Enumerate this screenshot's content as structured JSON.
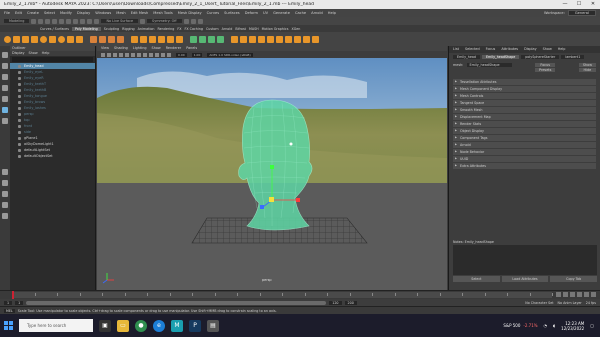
{
  "window": {
    "title": "Emily_2_1.mb* - Autodesk MAYA 2023: C:\\Users\\user\\Downloads\\Compressed\\Emily_2_1_Usert_Tutorial_Files\\Emily_2_1.mb   ---   Emily_head",
    "minimize": "—",
    "maximize": "☐",
    "close": "✕"
  },
  "menubar": {
    "items": [
      "File",
      "Edit",
      "Create",
      "Select",
      "Modify",
      "Display",
      "Windows",
      "Mesh",
      "Edit Mesh",
      "Mesh Tools",
      "Mesh Display",
      "Curves",
      "Surfaces",
      "Deform",
      "UV",
      "Generate",
      "Cache",
      "Arnold",
      "Help"
    ],
    "workspace_label": "Workspace:",
    "workspace_value": "General"
  },
  "statusline": {
    "mode": "Modeling",
    "live": "No Live Surface",
    "symmetry": "Symmetry: Off"
  },
  "shelf": {
    "tabs": [
      "Curves / Surfaces",
      "Poly Modeling",
      "Sculpting",
      "Rigging",
      "Animation",
      "Rendering",
      "FX",
      "FX Caching",
      "Custom",
      "Arnold",
      "Bifrost",
      "MASH",
      "Motion Graphics",
      "XGen"
    ],
    "active_tab": "Poly Modeling"
  },
  "outliner": {
    "title": "Outliner",
    "menu": [
      "Display",
      "Show",
      "Help"
    ],
    "items": [
      {
        "label": "Emily_head",
        "state": "selected"
      },
      {
        "label": "Emily_eyeL",
        "state": "dim"
      },
      {
        "label": "Emily_eyeR",
        "state": "dim"
      },
      {
        "label": "Emily_teethT",
        "state": "dim"
      },
      {
        "label": "Emily_teethB",
        "state": "dim"
      },
      {
        "label": "Emily_tongue",
        "state": "dim"
      },
      {
        "label": "Emily_brows",
        "state": "dim"
      },
      {
        "label": "Emily_lashes",
        "state": "dim"
      },
      {
        "label": "persp",
        "state": "dim"
      },
      {
        "label": "top",
        "state": "dim"
      },
      {
        "label": "front",
        "state": "dim"
      },
      {
        "label": "side",
        "state": "dim"
      },
      {
        "label": "gPlane1",
        "state": "normal"
      },
      {
        "label": "aiSkyDomeLight1",
        "state": "normal"
      },
      {
        "label": "defaultLightSet",
        "state": "normal"
      },
      {
        "label": "defaultObjectSet",
        "state": "normal"
      }
    ]
  },
  "viewport": {
    "menu": [
      "View",
      "Shading",
      "Lighting",
      "Show",
      "Renderer",
      "Panels"
    ],
    "resolution_gate": "0.00",
    "zoom": "1.00",
    "colorspace": "ACES 1.0 SDR-video (sRGB)",
    "camera": "persp"
  },
  "attribute_editor": {
    "tabs": [
      "List",
      "Selected",
      "Focus",
      "Attributes",
      "Display",
      "Show",
      "Help"
    ],
    "subtabs": [
      "Emily_head",
      "Emily_headShape",
      "polySphereStarter",
      "lambert1"
    ],
    "active_subtab": "Emily_headShape",
    "mesh_label": "mesh:",
    "mesh_value": "Emily_headShape",
    "buttons": [
      "Focus",
      "Presets",
      "Show",
      "Hide"
    ],
    "sections": [
      "Tessellation Attributes",
      "Mesh Component Display",
      "Mesh Controls",
      "Tangent Space",
      "Smooth Mesh",
      "Displacement Map",
      "Render Stats",
      "Object Display",
      "Component Tags",
      "Arnold",
      "Node Behavior",
      "UUID",
      "Extra Attributes"
    ],
    "notes_label": "Notes:  Emily_headShape",
    "bottom_buttons": [
      "Select",
      "Load Attributes",
      "Copy Tab"
    ]
  },
  "time": {
    "start": "1",
    "current": "1",
    "range_start": "1",
    "range_end": "120",
    "end": "200",
    "character_set": "No Character Set",
    "anim_layer": "No Anim Layer",
    "fps": "24 fps"
  },
  "helpline": {
    "lang": "MEL",
    "message": "Scale Tool: Use manipulator to scale objects. Ctrl+drag to scale components or drag to use manipulator. Use Shift+MMB drag to constrain scaling to an axis."
  },
  "taskbar": {
    "search_placeholder": "Type here to search",
    "stock_name": "S&P 500",
    "stock_change": "-2.71%",
    "time": "12:23 AM",
    "date": "12/23/2022"
  },
  "colors": {
    "accent": "#5285a6",
    "mesh": "#5ed6a4",
    "selected_edge": "#9ef0cf"
  }
}
